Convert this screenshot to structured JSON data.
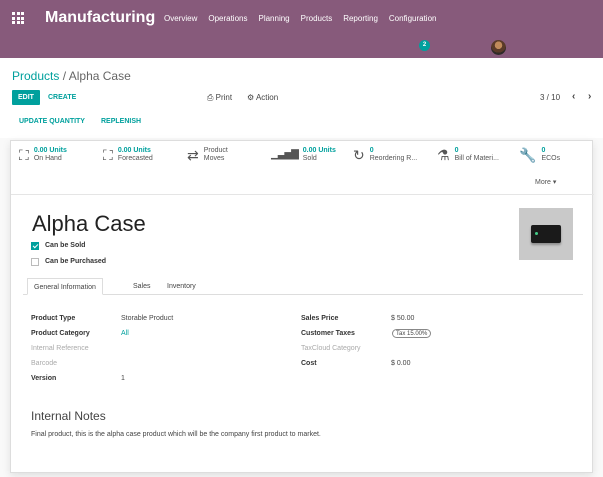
{
  "navbar": {
    "app_title": "Manufacturing",
    "menu": [
      "Overview",
      "Operations",
      "Planning",
      "Products",
      "Reporting",
      "Configuration"
    ],
    "chat_count": "2"
  },
  "breadcrumb": {
    "parent": "Products",
    "separator": "/",
    "current": "Alpha Case"
  },
  "toolbar": {
    "edit": "EDIT",
    "create": "CREATE",
    "print": "Print",
    "action": "Action",
    "pager": "3 / 10"
  },
  "action_bar": {
    "update_qty": "UPDATE QUANTITY",
    "replenish": "REPLENISH"
  },
  "smart_buttons": [
    {
      "value": "0.00 Units",
      "label": "On Hand",
      "icon": "cubes-icon"
    },
    {
      "value": "0.00 Units",
      "label": "Forecasted",
      "icon": "cubes-icon"
    },
    {
      "value": "Product",
      "label": "Moves",
      "icon": "exchange-icon"
    },
    {
      "value": "0.00 Units",
      "label": "Sold",
      "icon": "bar-chart-icon"
    },
    {
      "value": "0",
      "label": "Reordering R...",
      "icon": "refresh-icon"
    },
    {
      "value": "0",
      "label": "Bill of Materi...",
      "icon": "flask-icon"
    },
    {
      "value": "0",
      "label": "ECOs",
      "icon": "wrench-icon"
    }
  ],
  "more": "More",
  "product": {
    "name": "Alpha Case",
    "can_be_sold": "Can be Sold",
    "can_be_purchased": "Can be Purchased"
  },
  "tabs": [
    "General Information",
    "Sales",
    "Inventory"
  ],
  "fields_left": [
    {
      "label": "Product Type",
      "value": "Storable Product"
    },
    {
      "label": "Product Category",
      "value": "All"
    },
    {
      "label": "Internal Reference",
      "value": ""
    },
    {
      "label": "Barcode",
      "value": ""
    },
    {
      "label": "Version",
      "value": "1"
    }
  ],
  "fields_right": [
    {
      "label": "Sales Price",
      "value": "$ 50.00"
    },
    {
      "label": "Customer Taxes",
      "value": "Tax 15.00%"
    },
    {
      "label": "TaxCloud Category",
      "value": ""
    },
    {
      "label": "Cost",
      "value": "$ 0.00"
    }
  ],
  "notes": {
    "title": "Internal Notes",
    "text": "Final product, this is the alpha case product which will be the company first product to market."
  },
  "colors": {
    "brand": "#875a7b",
    "accent": "#00a09d"
  }
}
